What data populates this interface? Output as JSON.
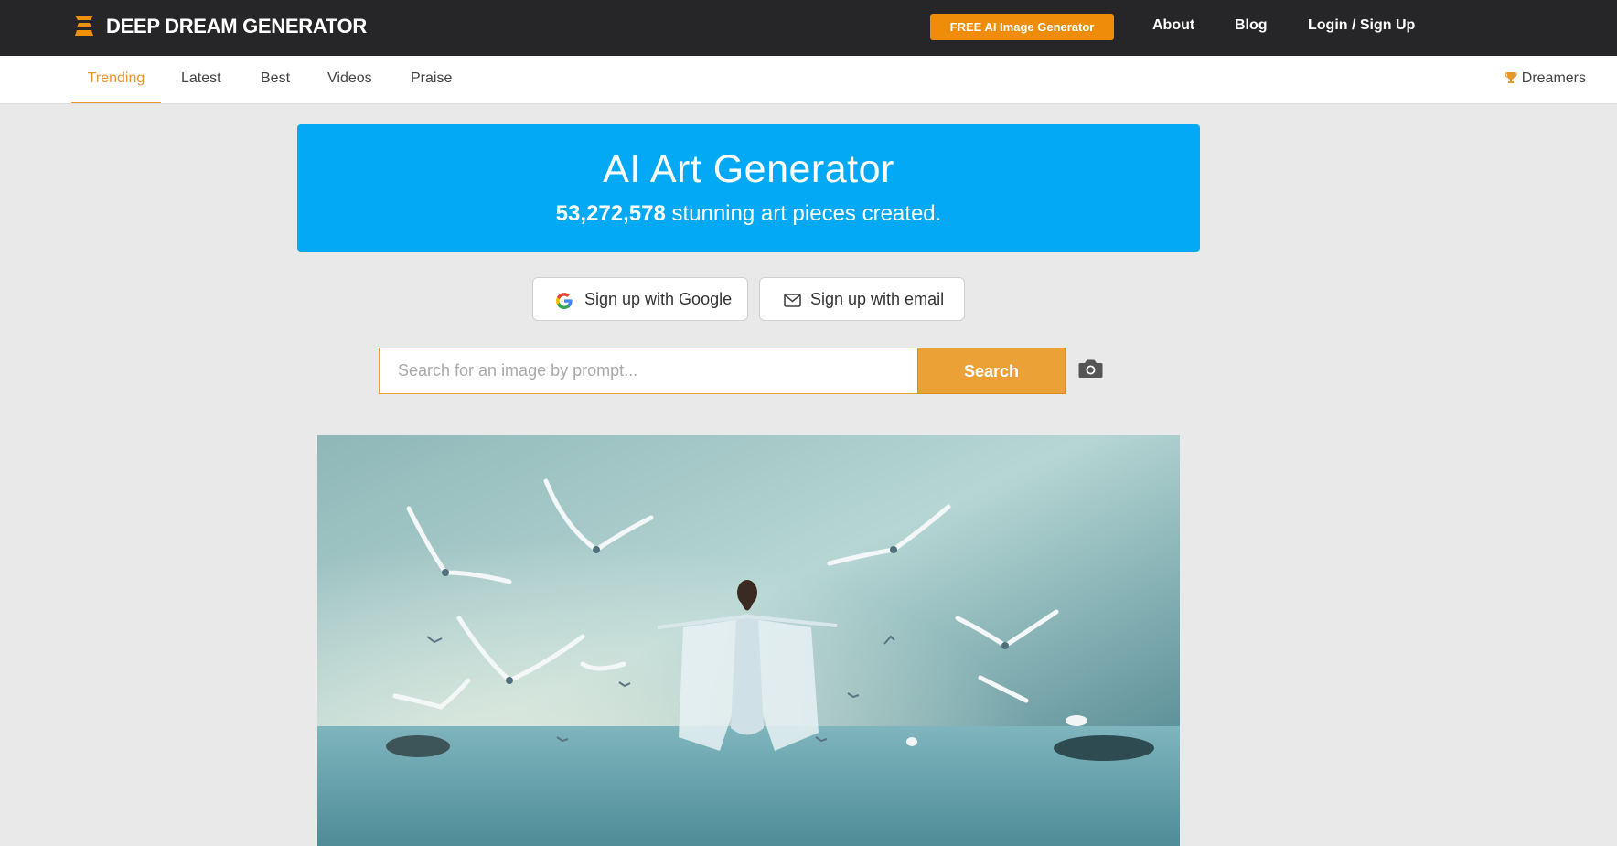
{
  "header": {
    "logo_text": "DEEP DREAM GENERATOR",
    "cta_label": "FREE AI Image Generator",
    "links": [
      "About",
      "Blog",
      "Login / Sign Up"
    ]
  },
  "tabs": {
    "items": [
      "Trending",
      "Latest",
      "Best",
      "Videos",
      "Praise"
    ],
    "active": "Trending",
    "dreamers_label": "Dreamers"
  },
  "hero": {
    "title": "AI Art Generator",
    "count": "53,272,578",
    "subtitle_suffix": " stunning art pieces created."
  },
  "signup": {
    "google_label": "Sign up with Google",
    "email_label": "Sign up with email"
  },
  "search": {
    "placeholder": "Search for an image by prompt...",
    "button_label": "Search"
  },
  "colors": {
    "topbar": "#262628",
    "accent_orange": "#ef8d0a",
    "hero_blue": "#03a9f4",
    "search_orange": "#eba135"
  },
  "icons": [
    "logo-icon",
    "trophy-icon",
    "google-icon",
    "mail-icon",
    "camera-icon"
  ]
}
